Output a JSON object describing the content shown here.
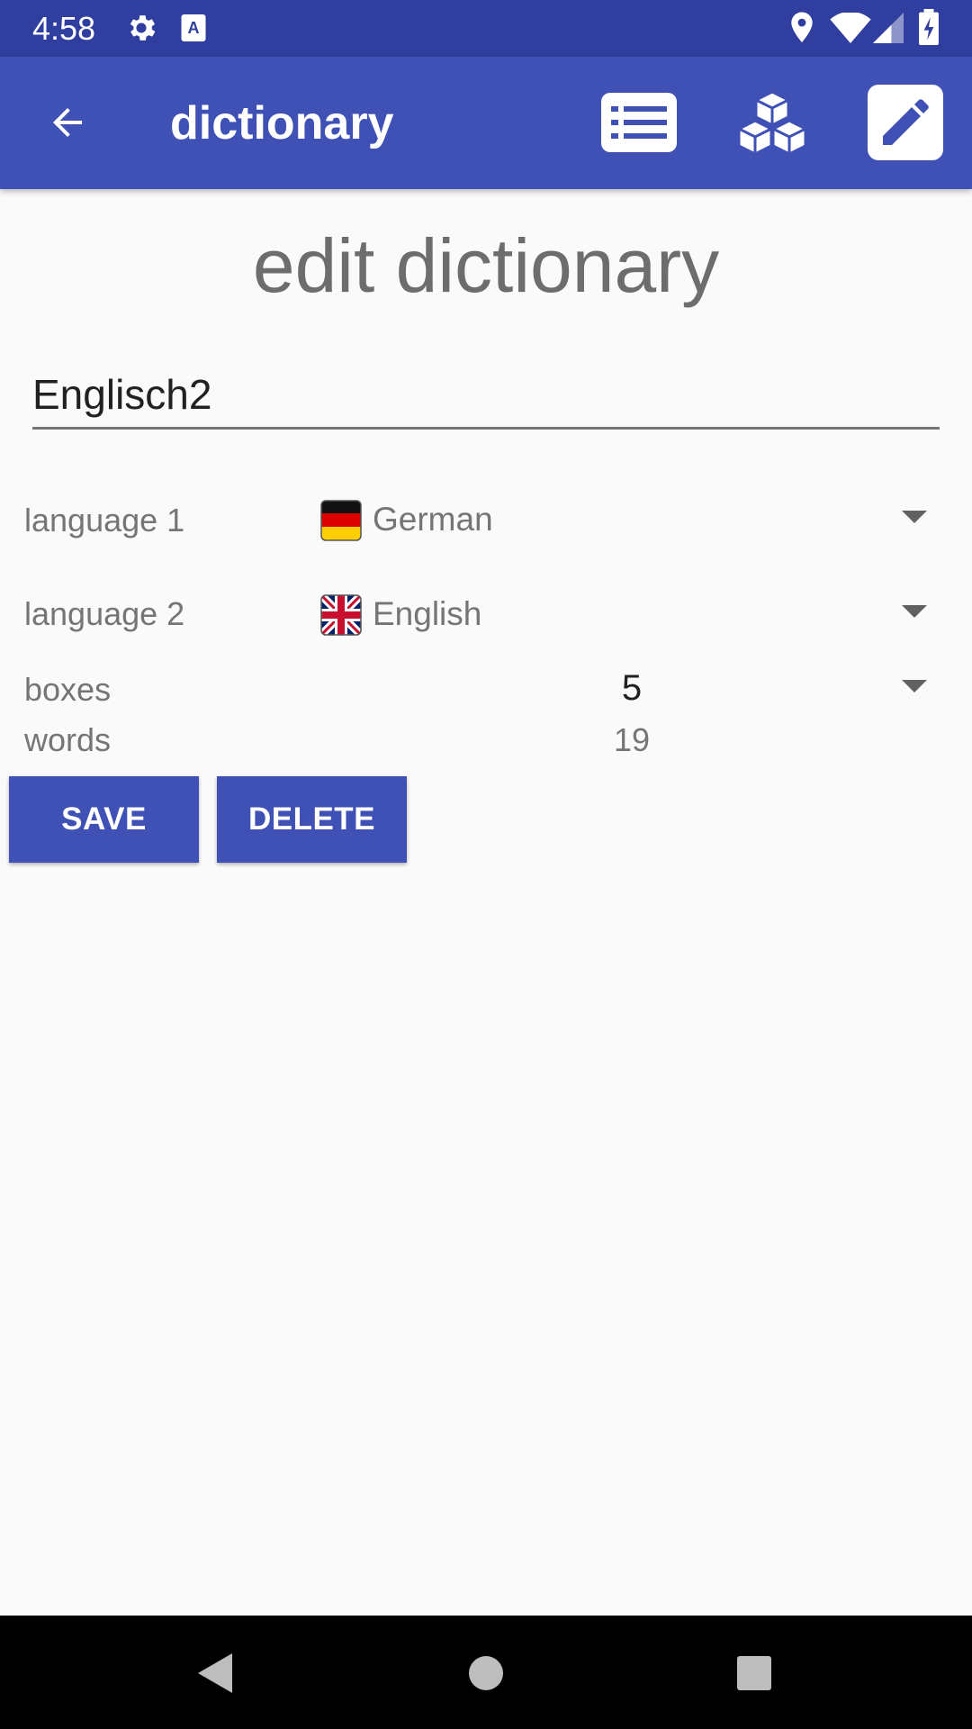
{
  "status_bar": {
    "time": "4:58",
    "left_icons": [
      "gear-icon",
      "keyboard-a-icon"
    ],
    "right_icons": [
      "location-icon",
      "wifi-icon",
      "signal-icon",
      "battery-charging-icon"
    ]
  },
  "app_bar": {
    "title": "dictionary",
    "actions": [
      "list-icon",
      "boxes-icon",
      "edit-icon"
    ]
  },
  "page": {
    "heading": "edit dictionary",
    "name_value": "Englisch2",
    "language1": {
      "label": "language 1",
      "value": "German",
      "flag": "germany-flag-icon"
    },
    "language2": {
      "label": "language 2",
      "value": "English",
      "flag": "uk-flag-icon"
    },
    "boxes": {
      "label": "boxes",
      "value": "5"
    },
    "words": {
      "label": "words",
      "value": "19"
    },
    "save_label": "SAVE",
    "delete_label": "DELETE"
  },
  "colors": {
    "primary": "#3f51b5",
    "primary_dark": "#303f9f",
    "background": "#fafafa"
  }
}
